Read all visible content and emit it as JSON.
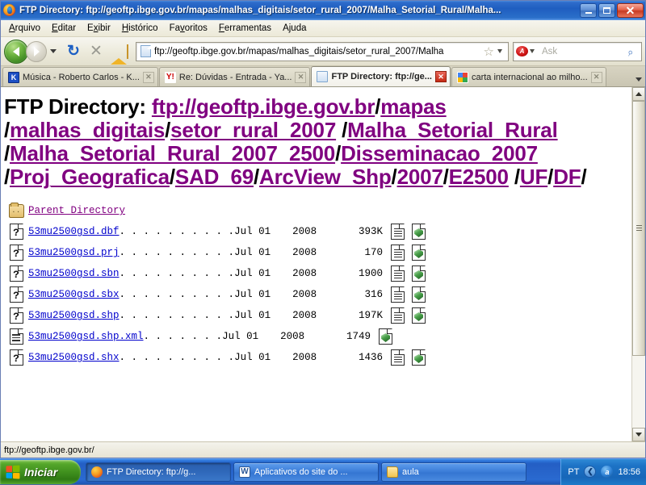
{
  "window": {
    "title": "FTP Directory: ftp://geoftp.ibge.gov.br/mapas/malhas_digitais/setor_rural_2007/Malha_Setorial_Rural/Malha...",
    "minimize_label": "",
    "maximize_label": "",
    "close_label": "✕"
  },
  "menubar": [
    {
      "label": "Arquivo",
      "accel": "A",
      "name": "menu-arquivo"
    },
    {
      "label": "Editar",
      "accel": "E",
      "name": "menu-editar"
    },
    {
      "label": "Exibir",
      "accel": "x",
      "name": "menu-exibir"
    },
    {
      "label": "Histórico",
      "accel": "H",
      "name": "menu-historico"
    },
    {
      "label": "Favoritos",
      "accel": "v",
      "name": "menu-favoritos"
    },
    {
      "label": "Ferramentas",
      "accel": "F",
      "name": "menu-ferramentas"
    },
    {
      "label": "Ajuda",
      "accel": "j",
      "name": "menu-ajuda"
    }
  ],
  "toolbar": {
    "back_icon": "back-arrow-icon",
    "forward_icon": "forward-arrow-icon",
    "history_caret_icon": "chevron-down-icon",
    "reload_glyph": "↻",
    "stop_glyph": "✕",
    "home_icon": "home-icon",
    "url_value": "ftp://geoftp.ibge.gov.br/mapas/malhas_digitais/setor_rural_2007/Malha",
    "bookmark_glyph": "☆",
    "search_engine": "Ask",
    "search_placeholder": "Ask",
    "search_glyph": "⌕"
  },
  "tabs": [
    {
      "title": "Música - Roberto Carlos - K...",
      "favicon": "kboing-favicon",
      "favicon_text": "K",
      "active": false,
      "close_glyph": "✕"
    },
    {
      "title": "Re: Dúvidas - Entrada - Ya...",
      "favicon": "yahoo-favicon",
      "favicon_text": "Y!",
      "active": false,
      "close_glyph": "✕"
    },
    {
      "title": "FTP Directory: ftp://ge...",
      "favicon": "document-favicon",
      "favicon_text": "",
      "active": true,
      "close_glyph": "✕"
    },
    {
      "title": "carta internacional ao milho...",
      "favicon": "google-favicon",
      "favicon_text": "",
      "active": false,
      "close_glyph": "✕"
    }
  ],
  "page": {
    "heading_prefix": "FTP Directory:",
    "heading_segments": [
      {
        "text": "ftp://geoftp.ibge.gov.br",
        "sep_before": ""
      },
      {
        "text": "mapas",
        "sep_before": "/"
      },
      {
        "text": "malhas_digitais",
        "sep_before": "/"
      },
      {
        "text": "setor_rural_2007",
        "sep_before": "/"
      },
      {
        "text": "Malha_Setorial_Rural",
        "sep_before": "/"
      },
      {
        "text": "Malha_Setorial_Rural_2007_2500",
        "sep_before": "/"
      },
      {
        "text": "Disseminacao_2007",
        "sep_before": "/"
      },
      {
        "text": "Proj_Geografica",
        "sep_before": "/"
      },
      {
        "text": "SAD_69",
        "sep_before": "/"
      },
      {
        "text": "ArcView_Shp",
        "sep_before": "/"
      },
      {
        "text": "2007",
        "sep_before": "/"
      },
      {
        "text": "E2500",
        "sep_before": "/"
      },
      {
        "text": "UF",
        "sep_before": "/"
      },
      {
        "text": "DF",
        "sep_before": "/"
      }
    ],
    "heading_suffix": "/",
    "parent_directory": {
      "label": "Parent Directory",
      "icon": "folder-up-icon"
    },
    "files": [
      {
        "name": "53mu2500gsd.dbf",
        "icon": "unknown-file-icon",
        "dots": ". . . . . . . . . .",
        "date": "Jul 01",
        "year": "2008",
        "size": "393K",
        "actions": [
          "view-text-icon",
          "view-shield-icon"
        ]
      },
      {
        "name": "53mu2500gsd.prj",
        "icon": "unknown-file-icon",
        "dots": ". . . . . . . . . .",
        "date": "Jul 01",
        "year": "2008",
        "size": "170",
        "actions": [
          "view-text-icon",
          "view-shield-icon"
        ]
      },
      {
        "name": "53mu2500gsd.sbn",
        "icon": "unknown-file-icon",
        "dots": ". . . . . . . . . .",
        "date": "Jul 01",
        "year": "2008",
        "size": "1900",
        "actions": [
          "view-text-icon",
          "view-shield-icon"
        ]
      },
      {
        "name": "53mu2500gsd.sbx",
        "icon": "unknown-file-icon",
        "dots": ". . . . . . . . . .",
        "date": "Jul 01",
        "year": "2008",
        "size": "316",
        "actions": [
          "view-text-icon",
          "view-shield-icon"
        ]
      },
      {
        "name": "53mu2500gsd.shp",
        "icon": "unknown-file-icon",
        "dots": ". . . . . . . . . .",
        "date": "Jul 01",
        "year": "2008",
        "size": "197K",
        "actions": [
          "view-text-icon",
          "view-shield-icon"
        ]
      },
      {
        "name": "53mu2500gsd.shp.xml",
        "icon": "text-file-icon",
        "dots": ". . . . . . .",
        "date": "Jul 01",
        "year": "2008",
        "size": "1749",
        "actions": [
          "view-shield-icon"
        ]
      },
      {
        "name": "53mu2500gsd.shx",
        "icon": "unknown-file-icon",
        "dots": ". . . . . . . . . .",
        "date": "Jul 01",
        "year": "2008",
        "size": "1436",
        "actions": [
          "view-text-icon",
          "view-shield-icon"
        ]
      }
    ]
  },
  "statusbar": {
    "text": "ftp://geoftp.ibge.gov.br/"
  },
  "taskbar": {
    "start_label": "Iniciar",
    "items": [
      {
        "label": "FTP Directory: ftp://g...",
        "icon": "firefox-icon",
        "icon_text": "",
        "pressed": true
      },
      {
        "label": "Aplicativos do site do ...",
        "icon": "word-icon",
        "icon_text": "W",
        "pressed": false
      },
      {
        "label": "aula",
        "icon": "folder-icon",
        "icon_text": "",
        "pressed": false
      }
    ],
    "tray": {
      "language": "PT",
      "chevron_glyph": "❮",
      "tray_icon_text": "a",
      "clock": "18:56"
    }
  },
  "colors": {
    "link": "#0000cc",
    "visited_link": "#800080",
    "titlebar_blue": "#1f5ec0",
    "taskbar_blue": "#245ec4",
    "start_green": "#3d8d1c"
  }
}
